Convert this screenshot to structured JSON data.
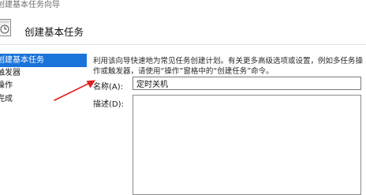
{
  "window": {
    "title": "创建基本任务向导"
  },
  "header": {
    "title": "创建基本任务",
    "icon": "task-scheduler-icon"
  },
  "steps": [
    {
      "label": "创建基本任务",
      "active": true
    },
    {
      "label": "触发器",
      "active": false
    },
    {
      "label": "操作",
      "active": false
    },
    {
      "label": "完成",
      "active": false
    }
  ],
  "main": {
    "description": "利用该向导快速地为常见任务创建计划。有关更多高级选项或设置，例如多任务操作或触发器，请使用“操作”窗格中的“创建任务”命令。",
    "name_label": "名称(A):",
    "name_value": "定时关机",
    "descr_label": "描述(D):",
    "descr_value": ""
  },
  "annotation": {
    "type": "red-arrow",
    "color": "#e02020"
  },
  "colors": {
    "active_step": "#1a73d9"
  }
}
